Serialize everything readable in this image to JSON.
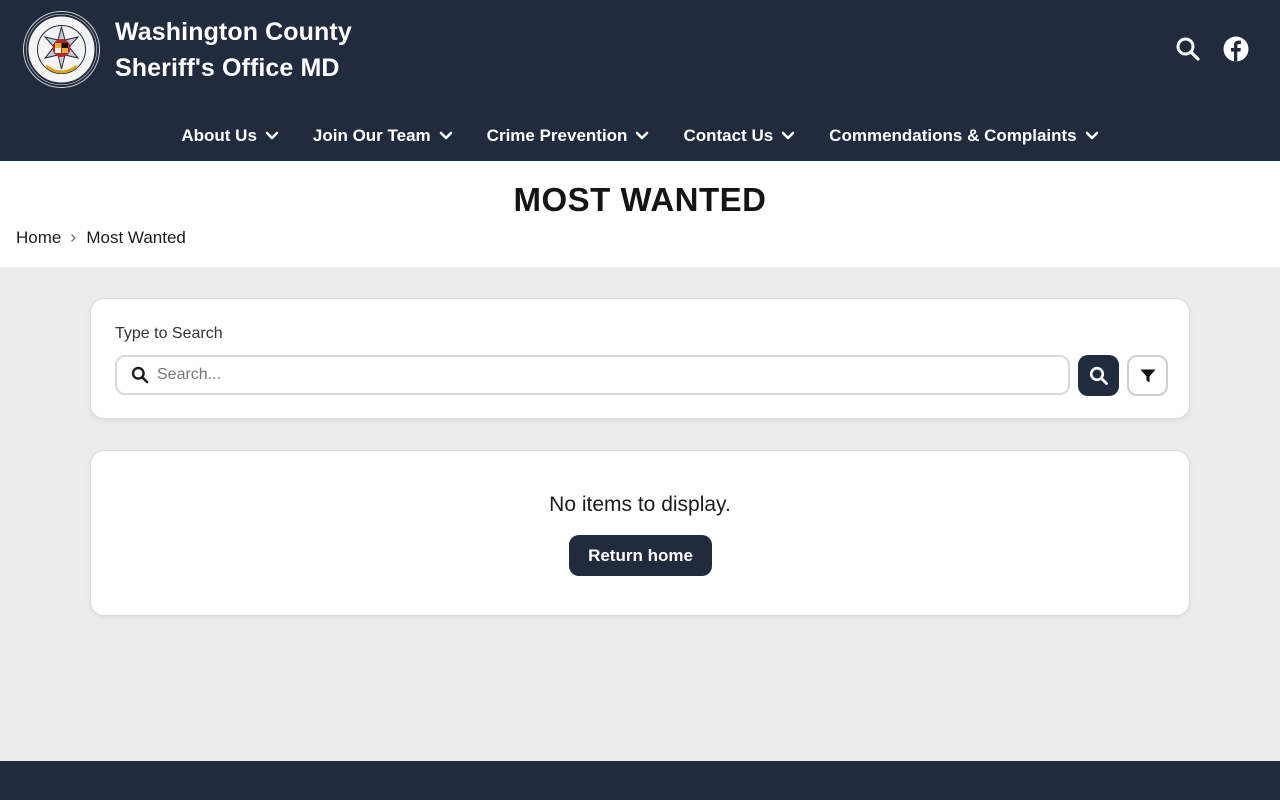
{
  "site": {
    "title_line1": "Washington County",
    "title_line2": "Sheriff's Office MD",
    "logo_icon": "sheriff-badge-seal",
    "brand_color": "#202b3e"
  },
  "header_icons": [
    {
      "name": "search-icon"
    },
    {
      "name": "facebook-icon"
    }
  ],
  "nav": {
    "items": [
      {
        "label": "About Us"
      },
      {
        "label": "Join Our Team"
      },
      {
        "label": "Crime Prevention"
      },
      {
        "label": "Contact Us"
      },
      {
        "label": "Commendations & Complaints"
      }
    ]
  },
  "page": {
    "title": "MOST WANTED",
    "breadcrumb": {
      "home": "Home",
      "current": "Most Wanted"
    }
  },
  "search": {
    "label": "Type to Search",
    "placeholder": "Search...",
    "value": ""
  },
  "results": {
    "empty_message": "No items to display.",
    "return_label": "Return home"
  }
}
